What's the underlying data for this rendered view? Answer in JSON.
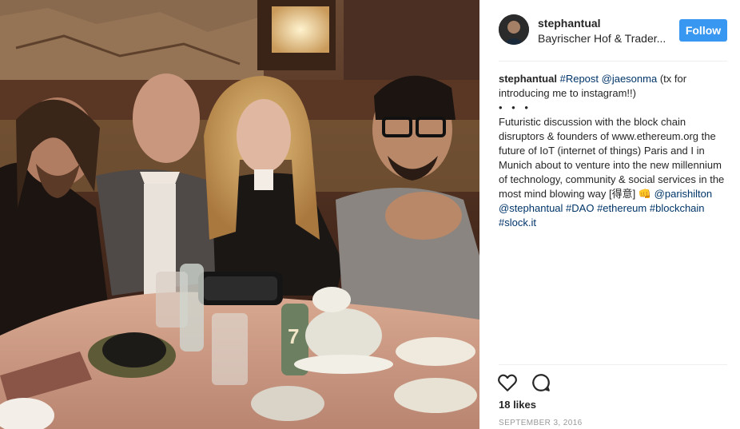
{
  "post": {
    "username": "stephantual",
    "location": "Bayrischer Hof & Trader...",
    "follow_label": "Follow"
  },
  "caption": {
    "username": "stephantual",
    "tag_repost": "#Repost",
    "mention_jaesonma": "@jaesonma",
    "text1": "(tx for introducing me to instagram!!)",
    "dots": "• • •",
    "text2": "Futuristic discussion with the block chain disruptors & founders of www.ethereum.org the future of IoT (internet of things) Paris and I in Munich about to venture into the new millennium of technology, community & social services in the most mind blowing way [得意] 👊",
    "mention_parishilton": "@parishilton",
    "mention_stephantual": "@stephantual",
    "tag_dao": "#DAO",
    "tag_ethereum": "#ethereum",
    "tag_blockchain": "#blockchain",
    "tag_slock": "#slock.it"
  },
  "stats": {
    "likes": "18 likes",
    "date": "SEPTEMBER 3, 2016"
  },
  "icons": {
    "like": "heart-icon",
    "comment": "comment-icon"
  },
  "colors": {
    "follow_button": "#3897f0",
    "link": "#003569",
    "date": "#999999"
  }
}
